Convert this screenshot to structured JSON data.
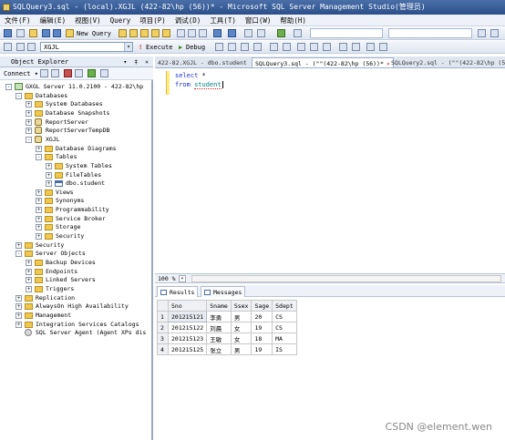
{
  "window": {
    "title": "SQLQuery3.sql - (local).XGJL (422-82\\hp (56))* - Microsoft SQL Server Management Studio(管理员)"
  },
  "menu": [
    "文件(F)",
    "编辑(E)",
    "视图(V)",
    "Query",
    "项目(P)",
    "调试(D)",
    "工具(T)",
    "窗口(W)",
    "帮助(H)"
  ],
  "toolbar": {
    "new_query": "New Query",
    "database": "XGJL",
    "execute": "Execute",
    "debug": "Debug"
  },
  "object_explorer": {
    "title": "Object Explorer",
    "pin_controls": "▾ ‡ ×",
    "connect": "Connect ▾",
    "tree": [
      {
        "label": "GXGL Server 11.0.2100 - 422-82\\hp",
        "level": 0,
        "icon": "server-icon",
        "exp": "-"
      },
      {
        "label": "Databases",
        "level": 1,
        "icon": "folder-icon",
        "exp": "-"
      },
      {
        "label": "System Databases",
        "level": 2,
        "icon": "folder-icon",
        "exp": "+"
      },
      {
        "label": "Database Snapshots",
        "level": 2,
        "icon": "folder-icon",
        "exp": "+"
      },
      {
        "label": "ReportServer",
        "level": 2,
        "icon": "database-icon",
        "exp": "+"
      },
      {
        "label": "ReportServerTempDB",
        "level": 2,
        "icon": "database-icon",
        "exp": "+"
      },
      {
        "label": "XGJL",
        "level": 2,
        "icon": "database-icon",
        "exp": "-"
      },
      {
        "label": "Database Diagrams",
        "level": 3,
        "icon": "folder-icon",
        "exp": "+"
      },
      {
        "label": "Tables",
        "level": 3,
        "icon": "folder-icon",
        "exp": "-"
      },
      {
        "label": "System Tables",
        "level": 4,
        "icon": "folder-icon",
        "exp": "+"
      },
      {
        "label": "FileTables",
        "level": 4,
        "icon": "folder-icon",
        "exp": "+"
      },
      {
        "label": "dbo.student",
        "level": 4,
        "icon": "table-icon",
        "exp": "+",
        "selected": true
      },
      {
        "label": "Views",
        "level": 3,
        "icon": "folder-icon",
        "exp": "+"
      },
      {
        "label": "Synonyms",
        "level": 3,
        "icon": "folder-icon",
        "exp": "+"
      },
      {
        "label": "Programmability",
        "level": 3,
        "icon": "folder-icon",
        "exp": "+"
      },
      {
        "label": "Service Broker",
        "level": 3,
        "icon": "folder-icon",
        "exp": "+"
      },
      {
        "label": "Storage",
        "level": 3,
        "icon": "folder-icon",
        "exp": "+"
      },
      {
        "label": "Security",
        "level": 3,
        "icon": "folder-icon",
        "exp": "+"
      },
      {
        "label": "Security",
        "level": 1,
        "icon": "folder-icon",
        "exp": "+"
      },
      {
        "label": "Server Objects",
        "level": 1,
        "icon": "folder-icon",
        "exp": "-"
      },
      {
        "label": "Backup Devices",
        "level": 2,
        "icon": "folder-icon",
        "exp": "+"
      },
      {
        "label": "Endpoints",
        "level": 2,
        "icon": "folder-icon",
        "exp": "+"
      },
      {
        "label": "Linked Servers",
        "level": 2,
        "icon": "folder-icon",
        "exp": "+"
      },
      {
        "label": "Triggers",
        "level": 2,
        "icon": "folder-icon",
        "exp": "+"
      },
      {
        "label": "Replication",
        "level": 1,
        "icon": "folder-icon",
        "exp": "+"
      },
      {
        "label": "AlwaysOn High Availability",
        "level": 1,
        "icon": "folder-icon",
        "exp": "+"
      },
      {
        "label": "Management",
        "level": 1,
        "icon": "folder-icon",
        "exp": "+"
      },
      {
        "label": "Integration Services Catalogs",
        "level": 1,
        "icon": "folder-icon",
        "exp": "+"
      },
      {
        "label": "SQL Server Agent (Agent XPs dis",
        "level": 1,
        "icon": "agent-icon",
        "exp": ""
      }
    ]
  },
  "tabs": [
    {
      "label": "422-82.XGJL - dbo.student",
      "active": false
    },
    {
      "label": "SQLQuery3.sql - (\"\"(422-82\\hp (56))*",
      "active": true
    },
    {
      "label": "SQLQuery2.sql - (\"\"(422-82\\hp (55)",
      "active": false
    }
  ],
  "editor": {
    "line1_kw": "select",
    "line1_rest": " *",
    "line2_kw": "from",
    "line2_rest": "student"
  },
  "zoom": "100 %",
  "results": {
    "tab_results": "Results",
    "tab_messages": "Messages",
    "columns": [
      "Sno",
      "Sname",
      "Ssex",
      "Sage",
      "Sdept"
    ],
    "rows": [
      [
        "1",
        "201215121",
        "李勇",
        "男",
        "20",
        "CS"
      ],
      [
        "2",
        "201215122",
        "刘晨",
        "女",
        "19",
        "CS"
      ],
      [
        "3",
        "201215123",
        "王敏",
        "女",
        "18",
        "MA"
      ],
      [
        "4",
        "201215125",
        "张立",
        "男",
        "19",
        "IS"
      ]
    ]
  },
  "watermark": "CSDN @element.wen"
}
